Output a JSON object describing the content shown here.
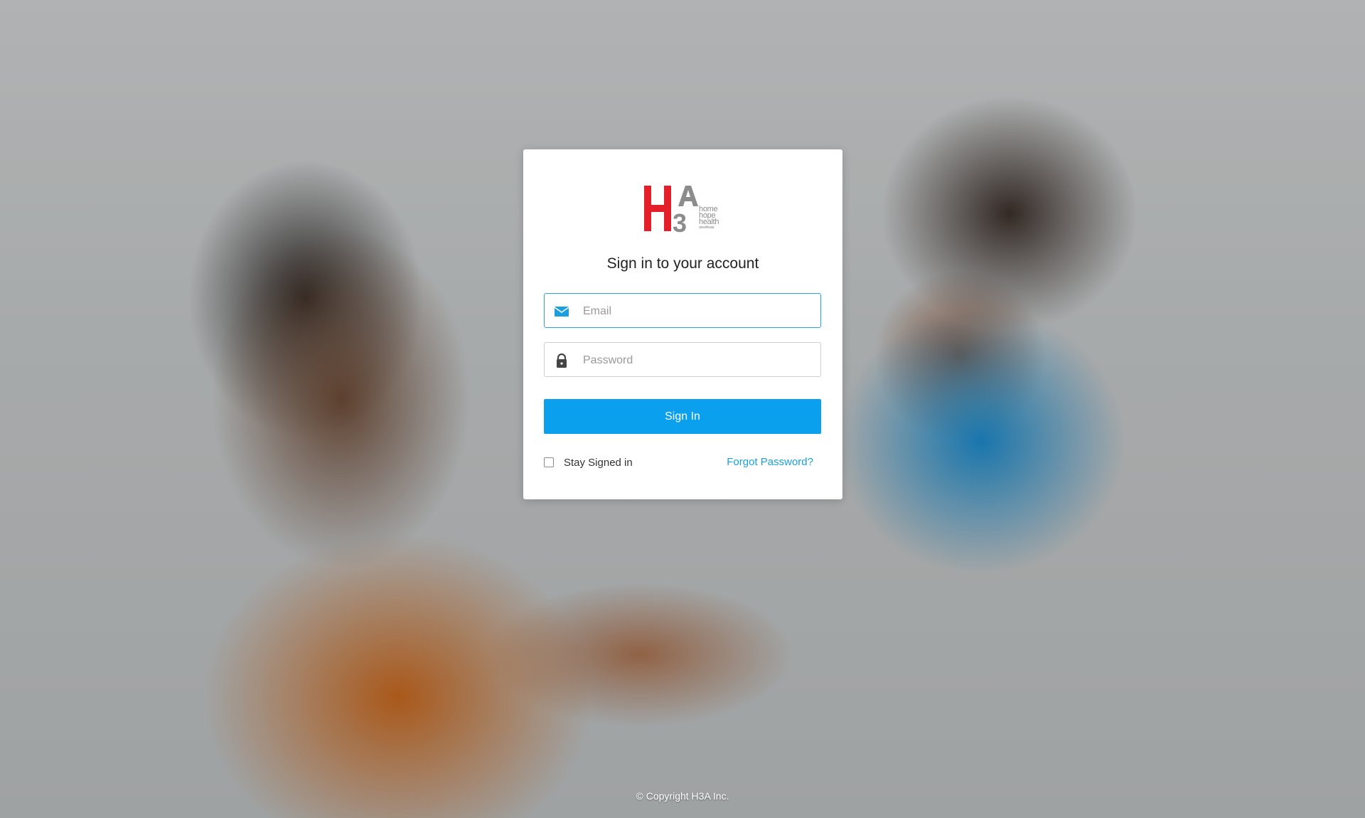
{
  "login_card": {
    "logo": {
      "letters": "H3A",
      "tagline_lines": [
        "home",
        "hope",
        "health",
        "anesthesia"
      ]
    },
    "title": "Sign in to your account",
    "email": {
      "placeholder": "Email",
      "value": "",
      "icon": "envelope-icon"
    },
    "password": {
      "placeholder": "Password",
      "value": "",
      "icon": "lock-icon"
    },
    "sign_in_label": "Sign In",
    "stay_signed_in": {
      "label": "Stay Signed in",
      "checked": false
    },
    "forgot_password_label": "Forgot Password?"
  },
  "footer": {
    "copyright": "© Copyright H3A Inc."
  },
  "colors": {
    "accent": "#0aa0ee",
    "link": "#1a9fe0",
    "logo_red": "#e3202a",
    "logo_gray": "#8c8c8c"
  }
}
